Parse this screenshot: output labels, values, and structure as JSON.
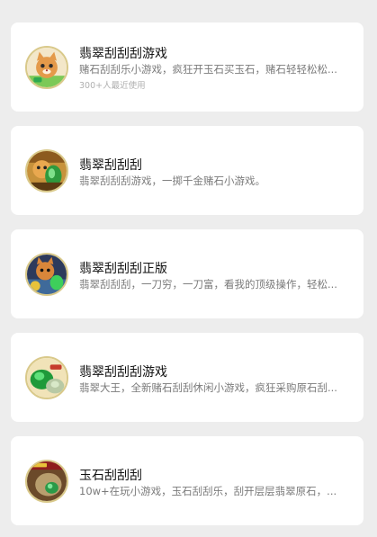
{
  "games": [
    {
      "title": "翡翠刮刮刮游戏",
      "description": "赌石刮刮乐小游戏，疯狂开玉石买玉石，赌石轻轻松松...",
      "meta": "300+人最近使用",
      "icon": "cat-mascot-icon"
    },
    {
      "title": "翡翠刮刮刮",
      "description": "翡翠刮刮刮游戏，一掷千金赌石小游戏。",
      "icon": "cat-jade-icon"
    },
    {
      "title": "翡翠刮刮刮正版",
      "description": "翡翠刮刮刮，一刀穷，一刀富，看我的顶级操作，轻松...",
      "icon": "cat-warrior-icon"
    },
    {
      "title": "翡翠刮刮刮游戏",
      "description": "翡翠大王，全新赌石刮刮休闲小游戏，疯狂采购原石刮...",
      "icon": "jade-stone-icon"
    },
    {
      "title": "玉石刮刮刮",
      "description": "10w+在玩小游戏，玉石刮刮乐，刮开层层翡翠原石，...",
      "icon": "jade-rock-icon"
    }
  ],
  "colors": {
    "background": "#ededed",
    "card": "#ffffff",
    "title": "#111111",
    "description": "#7a7a7a",
    "meta": "#b0b0b0"
  }
}
